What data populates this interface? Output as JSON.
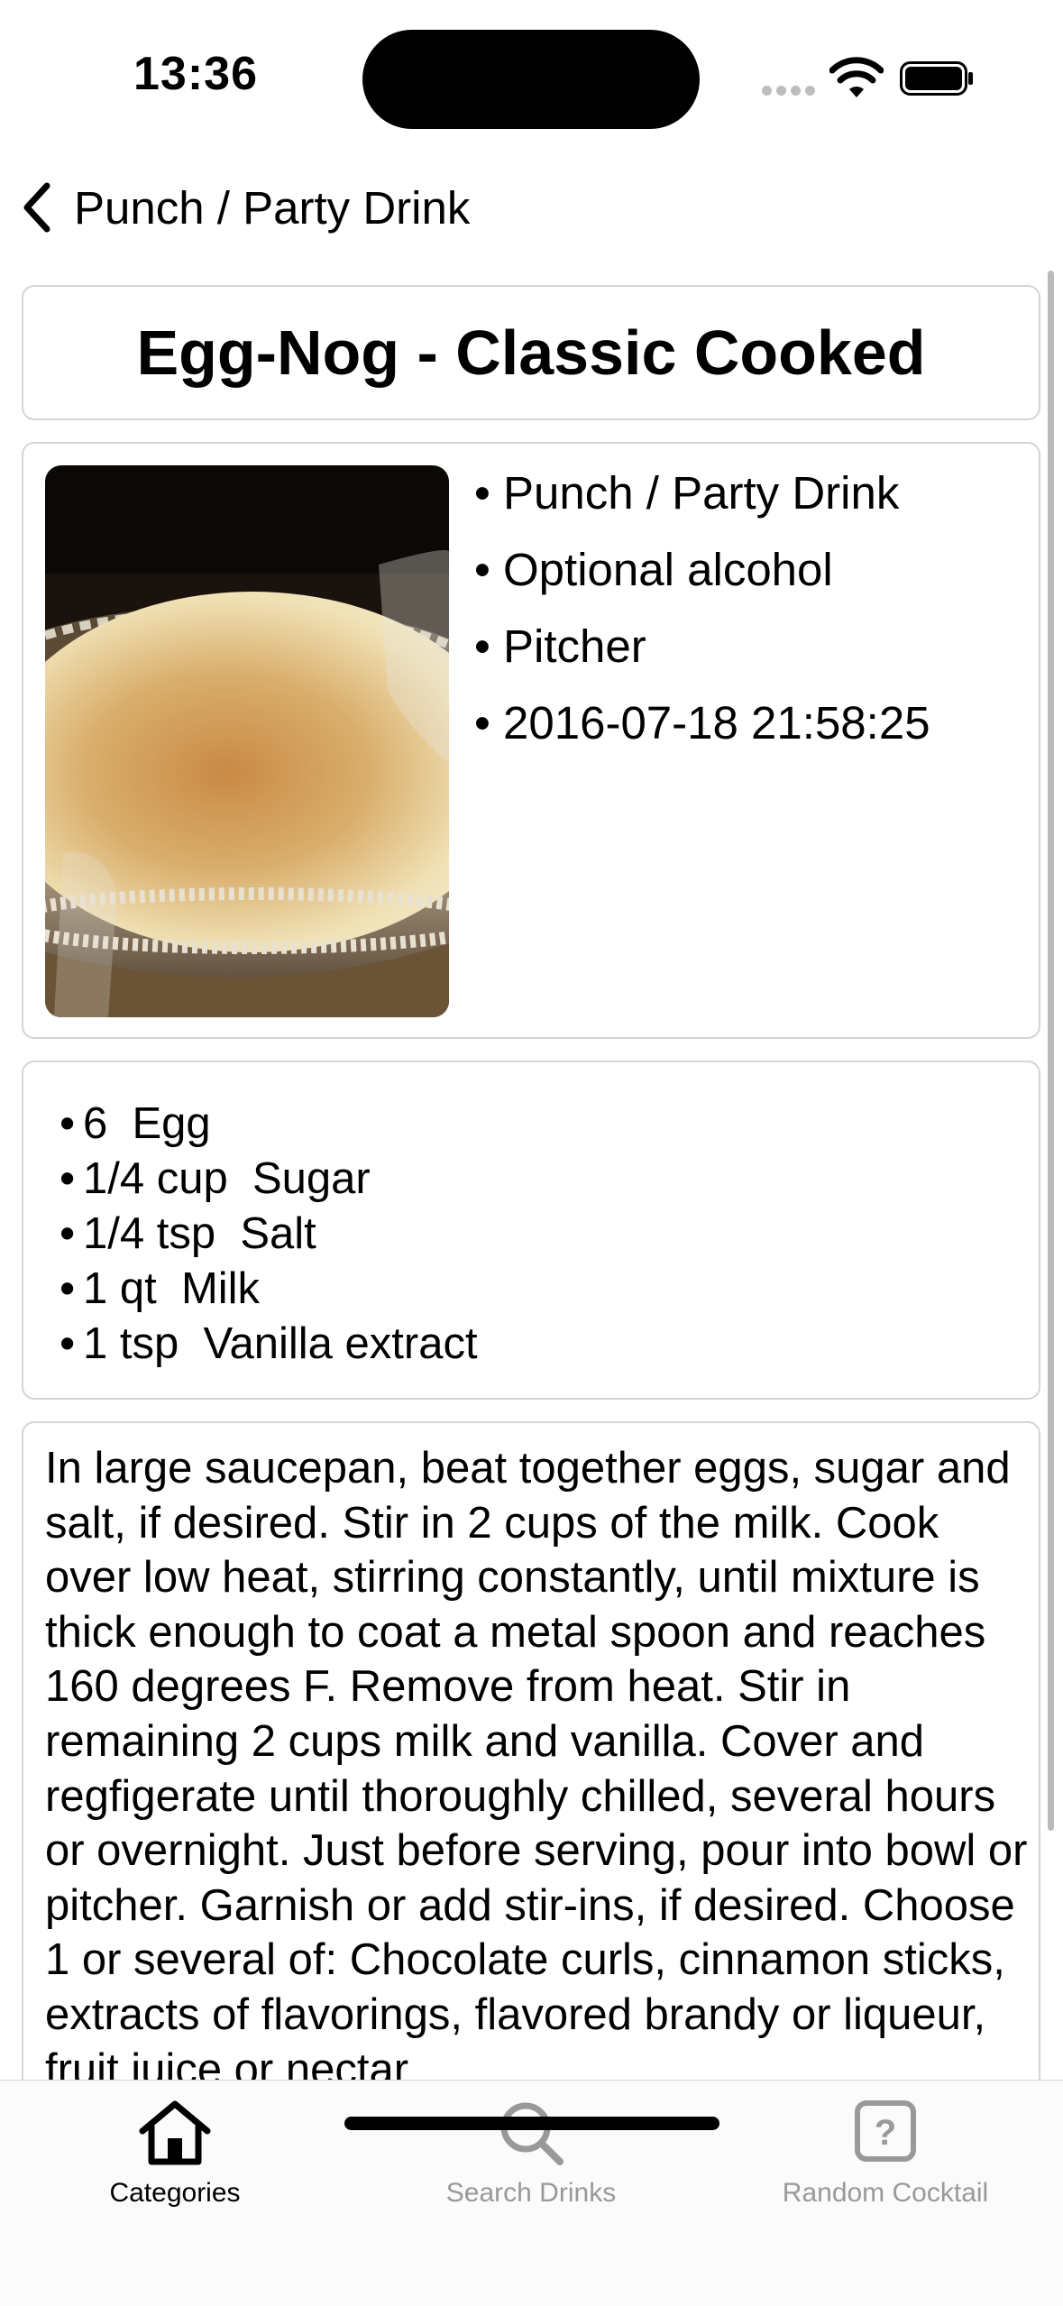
{
  "status_bar": {
    "time": "13:36"
  },
  "nav": {
    "back_label": "Punch / Party Drink"
  },
  "drink": {
    "title": "Egg-Nog - Classic Cooked",
    "photo_alt": "Egg-Nog - Classic Cooked",
    "meta": [
      "Punch / Party Drink",
      "Optional alcohol",
      "Pitcher",
      "2016-07-18 21:58:25"
    ],
    "ingredients": [
      "6  Egg",
      "1/4 cup  Sugar",
      "1/4 tsp  Salt",
      "1 qt  Milk",
      "1 tsp  Vanilla extract"
    ],
    "instructions": "In large saucepan, beat together eggs, sugar and salt, if desired. Stir in 2 cups of the milk. Cook over low heat, stirring constantly, until mixture is thick enough to coat a metal spoon and reaches 160 degrees F. Remove from heat. Stir in remaining 2 cups milk and vanilla. Cover and regfigerate until thoroughly chilled, several hours or overnight. Just before serving, pour into bowl or pitcher. Garnish or add stir-ins, if desired. Choose 1 or several of: Chocolate curls, cinnamon sticks, extracts of flavorings, flavored brandy or liqueur, fruit juice or nectar"
  },
  "tabs": [
    {
      "label": "Categories",
      "icon": "house-icon",
      "active": true
    },
    {
      "label": "Search Drinks",
      "icon": "magnifier-icon",
      "active": false
    },
    {
      "label": "Random Cocktail",
      "icon": "question-square-icon",
      "active": false
    }
  ],
  "colors": {
    "active": "#000000",
    "inactive": "#999999",
    "border": "#d4d4d4"
  }
}
